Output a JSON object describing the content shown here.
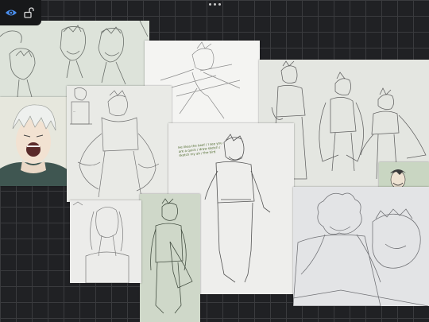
{
  "toolbar": {
    "visibility_icon": "eye-icon",
    "lock_icon": "unlock-icon",
    "more_icon": "more-dots-icon"
  },
  "canvas": {
    "background_color": "#202124",
    "grid_color": "#3a3b3e"
  },
  "notes": {
    "annotation": "He likes the beef / I see you are a quick / draw sketch / sketch my ah / the bird",
    "character_sheet_text": "..."
  }
}
